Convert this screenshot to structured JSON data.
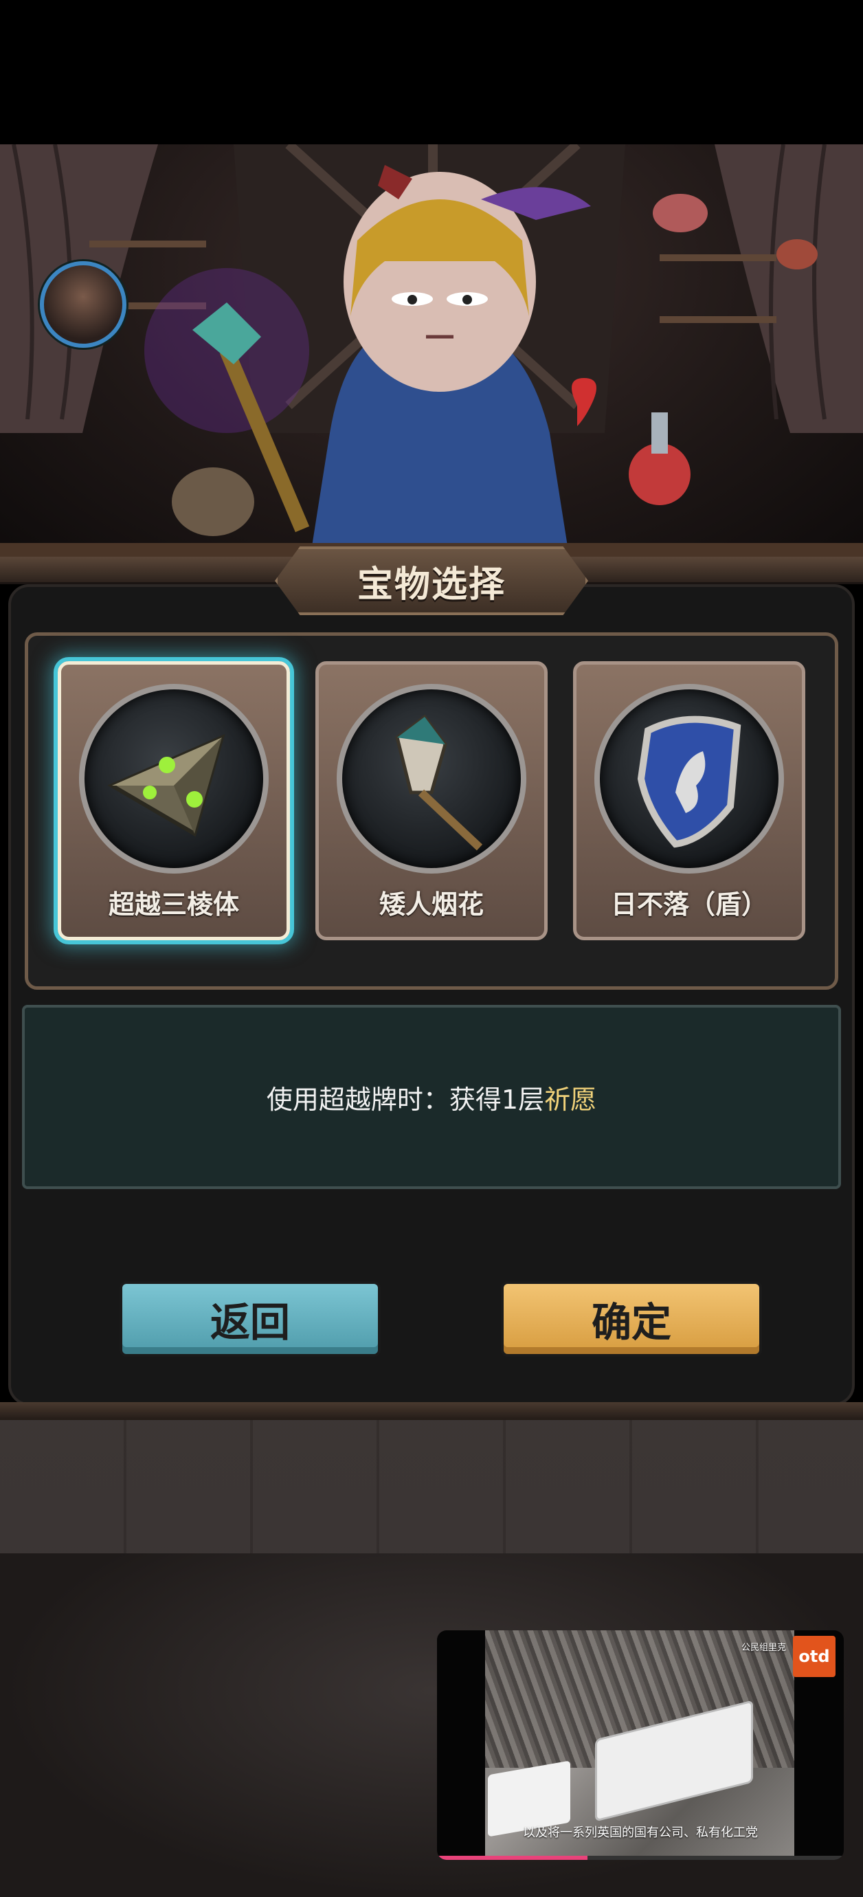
{
  "header": {
    "title": "宝物选择"
  },
  "player": {
    "avatar_icon": "player-avatar-icon"
  },
  "treasures": [
    {
      "name": "超越三棱体",
      "icon": "prism-icon",
      "selected": true
    },
    {
      "name": "矮人烟花",
      "icon": "firework-icon",
      "selected": false
    },
    {
      "name": "日不落（盾）",
      "icon": "shield-icon",
      "selected": false
    }
  ],
  "description": {
    "text": "使用超越牌时：获得1层",
    "highlight": "祈愿"
  },
  "buttons": {
    "back": "返回",
    "confirm": "确定"
  },
  "video": {
    "logo": "otd",
    "top_caption": "公民组里克",
    "caption": "以及将一系列英国的国有公司、私有化工党",
    "progress": 0.37
  },
  "colors": {
    "selected_glow": "#47c6d8",
    "highlight": "#f1d27a",
    "back_button": "#7cc5d3",
    "confirm_button": "#f2c473"
  }
}
